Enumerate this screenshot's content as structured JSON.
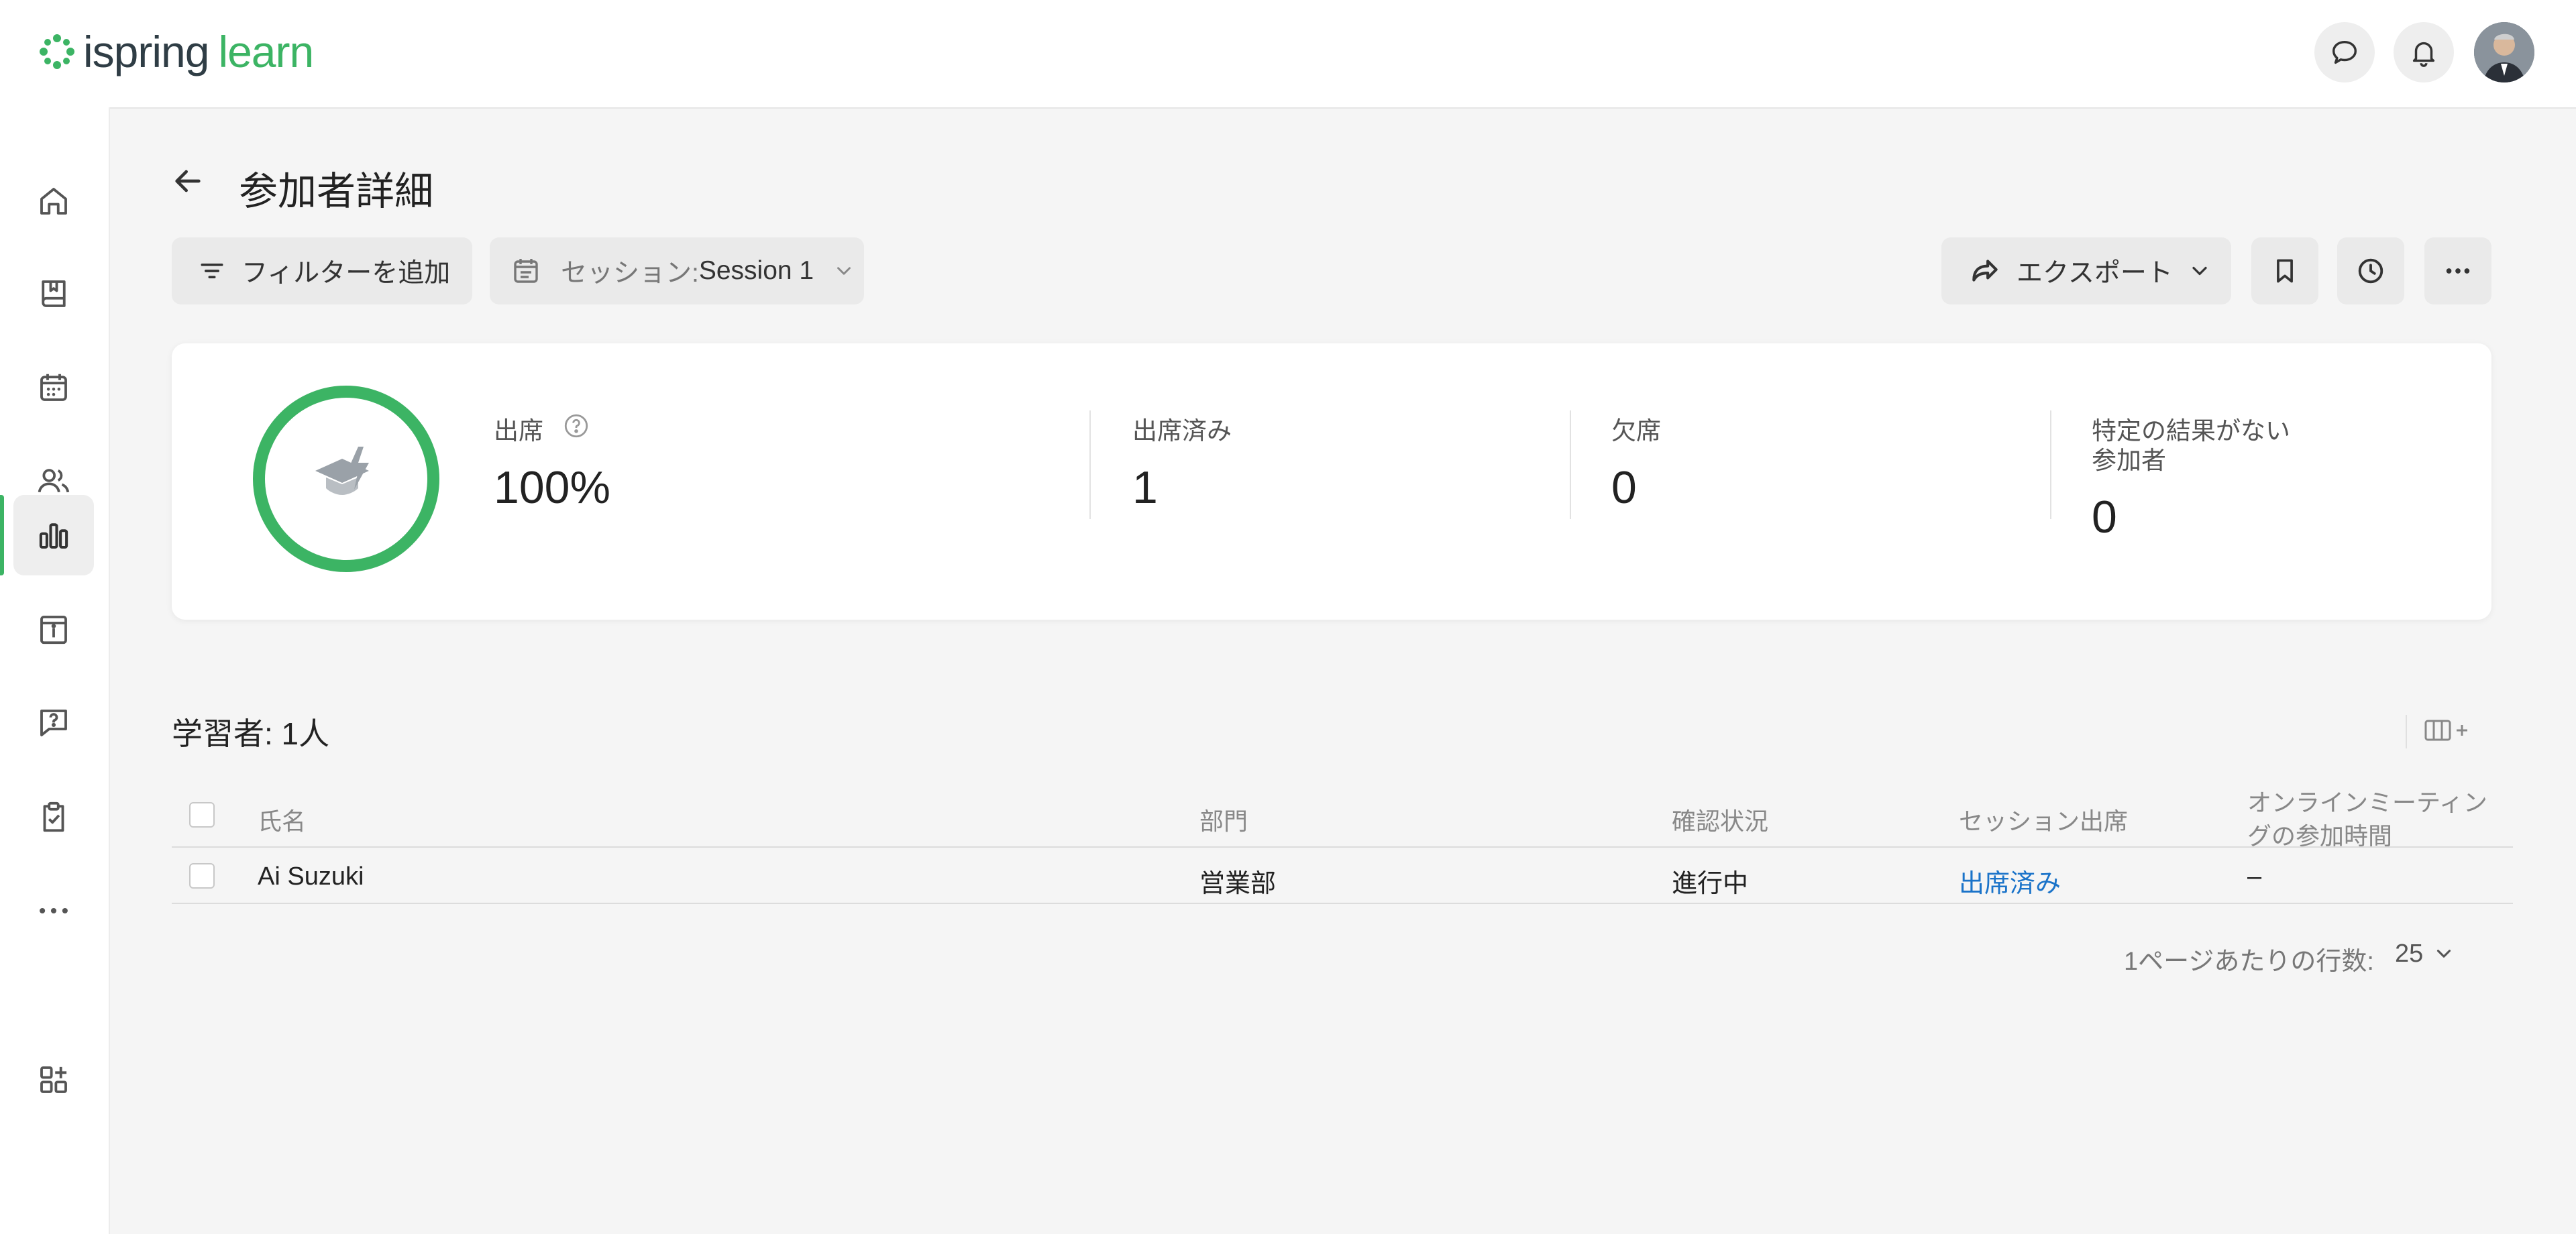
{
  "app": {
    "logo_main": "ispring",
    "logo_accent": "learn"
  },
  "header": {
    "chat_icon": "chat-bubble-icon",
    "bell_icon": "bell-icon"
  },
  "sidebar": {
    "items": [
      {
        "name": "home",
        "icon": "home-icon"
      },
      {
        "name": "courses",
        "icon": "book-icon"
      },
      {
        "name": "calendar",
        "icon": "calendar-icon"
      },
      {
        "name": "users",
        "icon": "users-icon"
      },
      {
        "name": "reports",
        "icon": "bar-chart-icon",
        "active": true
      },
      {
        "name": "info",
        "icon": "info-board-icon"
      },
      {
        "name": "help",
        "icon": "question-chat-icon"
      },
      {
        "name": "tasks",
        "icon": "clipboard-check-icon"
      },
      {
        "name": "more",
        "icon": "more-dots-icon"
      },
      {
        "name": "apps",
        "icon": "add-widgets-icon"
      }
    ]
  },
  "page": {
    "title": "参加者詳細"
  },
  "toolbar": {
    "add_filter": "フィルターを追加",
    "session_prefix": "セッション: ",
    "session_value": "Session 1",
    "export": "エクスポート"
  },
  "stats": {
    "attendance_label": "出席",
    "attendance_value": "100%",
    "attendance_percent": 100,
    "attended_label": "出席済み",
    "attended_value": "1",
    "absent_label": "欠席",
    "absent_value": "0",
    "noresult_label_1": "特定の結果がない",
    "noresult_label_2": "参加者",
    "noresult_value": "0"
  },
  "colors": {
    "accent": "#3cb464",
    "link": "#1a73c9"
  },
  "table": {
    "count_label": "学習者: 1人",
    "columns": {
      "name": "氏名",
      "dept": "部門",
      "status": "確認状況",
      "session": "セッション出席",
      "online_1": "オンラインミーティン",
      "online_2": "グの参加時間"
    },
    "rows": [
      {
        "name": "Ai Suzuki",
        "dept": "営業部",
        "status": "進行中",
        "session": "出席済み",
        "online": "–"
      }
    ]
  },
  "pagination": {
    "label": "1ページあたりの行数:",
    "value": "25"
  }
}
